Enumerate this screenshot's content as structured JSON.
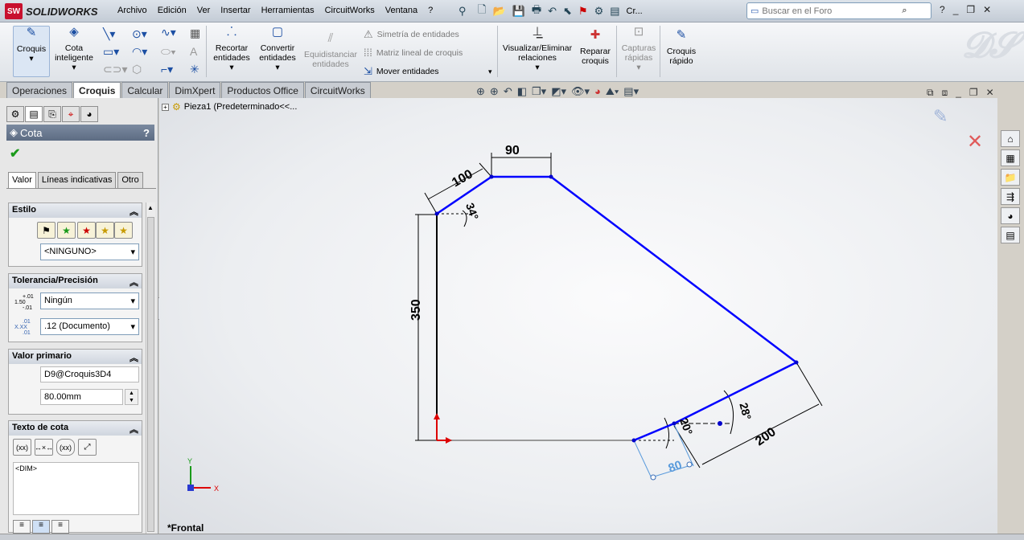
{
  "app": {
    "brand": "SOLIDWORKS",
    "brand_badge": "SW"
  },
  "menus": [
    "Archivo",
    "Edición",
    "Ver",
    "Insertar",
    "Herramientas",
    "CircuitWorks",
    "Ventana",
    "?"
  ],
  "quick_label": "Cr...",
  "search": {
    "placeholder": "Buscar en el Foro"
  },
  "ribbon": {
    "croquis": "Croquis",
    "cota": "Cota inteligente",
    "recortar": "Recortar entidades",
    "convertir": "Convertir entidades",
    "equidistanciar": "Equidistanciar entidades",
    "simetria": "Simetría de entidades",
    "matriz": "Matriz lineal de croquis",
    "mover": "Mover entidades",
    "visualizar": "Visualizar/Eliminar relaciones",
    "reparar": "Reparar croquis",
    "capturas": "Capturas rápidas",
    "croquis_rapido": "Croquis rápido"
  },
  "tabs": [
    "Operaciones",
    "Croquis",
    "Calcular",
    "DimXpert",
    "Productos Office",
    "CircuitWorks"
  ],
  "tree": {
    "item": "Pieza1  (Predeterminado<<..."
  },
  "property_manager": {
    "title": "Cota",
    "help": "?",
    "subtabs": [
      "Valor",
      "Líneas indicativas",
      "Otro"
    ],
    "estilo": {
      "header": "Estilo",
      "value": "<NINGUNO>"
    },
    "tolerancia": {
      "header": "Tolerancia/Precisión",
      "tol_value": "Ningún",
      "prec_value": ".12 (Documento)",
      "tol_icon_label": "1.50",
      "tol_icon_sup": "+.01",
      "tol_icon_sub": "-.01",
      "prec_icon_label": "X.XX",
      "prec_icon_sup": ".01",
      "prec_icon_sub": ".01"
    },
    "valor_primario": {
      "header": "Valor primario",
      "name": "D9@Croquis3D4",
      "value": "80.00mm"
    },
    "texto_cota": {
      "header": "Texto de cota",
      "text": "<DIM>",
      "btn1": "(xx)",
      "btn3": "(xx)"
    }
  },
  "sketch": {
    "dims": {
      "d90": "90",
      "d100": "100",
      "d34": "34°",
      "d350": "350",
      "d200": "200",
      "d28": "28°",
      "d20": "20°",
      "d80": "80"
    },
    "axis_y": "Y",
    "axis_x": "X"
  },
  "view_label": "*Frontal",
  "colors": {
    "sketch_blue": "#0000ff",
    "sketch_black": "#000000",
    "dim_selected": "#5a9bdc",
    "ribbon_icon": "#1c4fa3"
  }
}
